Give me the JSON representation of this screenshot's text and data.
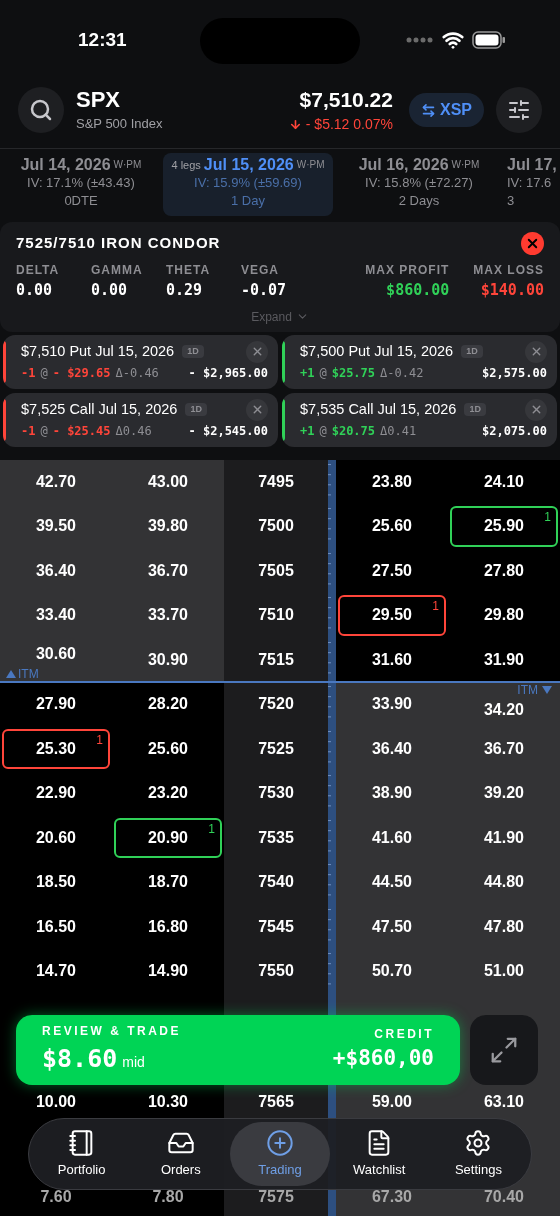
{
  "status_bar": {
    "time": "12:31"
  },
  "header": {
    "symbol": "SPX",
    "name": "S&P 500 Index",
    "price": "$7,510.22",
    "change": "- $5.12 0.07%",
    "down": true,
    "alt_symbol": "XSP"
  },
  "expirations": [
    {
      "date": "Jul 14, 2026",
      "tag": "W·PM",
      "iv": "IV: 17.1% (±43.43)",
      "dte": "0DTE",
      "selected": false
    },
    {
      "date": "Jul 15, 2026",
      "tag": "W·PM",
      "legs": "4 legs",
      "iv": "IV: 15.9% (±59.69)",
      "dte": "1 Day",
      "selected": true
    },
    {
      "date": "Jul 16, 2026",
      "tag": "W·PM",
      "iv": "IV: 15.8% (±72.27)",
      "dte": "2 Days",
      "selected": false
    },
    {
      "date": "Jul 17,",
      "iv": "IV: 17.6",
      "dte": "3",
      "selected": false
    }
  ],
  "strategy": {
    "title": "7525/7510 IRON CONDOR",
    "greeks": [
      {
        "label": "DELTA",
        "value": "0.00"
      },
      {
        "label": "GAMMA",
        "value": "0.00"
      },
      {
        "label": "THETA",
        "value": "0.29"
      },
      {
        "label": "VEGA",
        "value": "-0.07"
      }
    ],
    "limits": [
      {
        "label": "MAX PROFIT",
        "value": "$860.00",
        "color": "#30d158"
      },
      {
        "label": "MAX LOSS",
        "value": "$140.00",
        "color": "#ff453a"
      }
    ],
    "expand": "Expand"
  },
  "legs": [
    {
      "title": "$7,510 Put Jul 15, 2026",
      "tag": "1D",
      "color": "#ff453a",
      "qty": "-1",
      "at": "@",
      "price": "- $29.65",
      "delta": "Δ-0.46",
      "total": "- $2,965.00"
    },
    {
      "title": "$7,500 Put Jul 15, 2026",
      "tag": "1D",
      "color": "#30d158",
      "qty": "+1",
      "at": "@",
      "price": "$25.75",
      "delta": "Δ-0.42",
      "total": "$2,575.00"
    },
    {
      "title": "$7,525 Call Jul 15, 2026",
      "tag": "1D",
      "color": "#ff453a",
      "qty": "-1",
      "at": "@",
      "price": "- $25.45",
      "delta": "Δ0.46",
      "total": "- $2,545.00"
    },
    {
      "title": "$7,535 Call Jul 15, 2026",
      "tag": "1D",
      "color": "#30d158",
      "qty": "+1",
      "at": "@",
      "price": "$20.75",
      "delta": "Δ0.41",
      "total": "$2,075.00"
    }
  ],
  "chain": {
    "itm_label_calls": "ITM",
    "itm_label_puts": "ITM",
    "rows": [
      {
        "strike": "7495",
        "call_itm": true,
        "put_itm": false,
        "cells": [
          {
            "text": "42.70",
            "selected": false
          },
          {
            "text": "43.00",
            "selected": false
          },
          {
            "text": "23.80",
            "selected": false
          },
          {
            "text": "24.10",
            "selected": false
          }
        ]
      },
      {
        "strike": "7500",
        "call_itm": true,
        "put_itm": false,
        "cells": [
          {
            "text": "39.50",
            "selected": false
          },
          {
            "text": "39.80",
            "selected": false
          },
          {
            "text": "25.60",
            "selected": false
          },
          {
            "text": "25.90",
            "selected": true,
            "color": "#30d158",
            "qty": "1"
          }
        ]
      },
      {
        "strike": "7505",
        "call_itm": true,
        "put_itm": false,
        "cells": [
          {
            "text": "36.40",
            "selected": false
          },
          {
            "text": "36.70",
            "selected": false
          },
          {
            "text": "27.50",
            "selected": false
          },
          {
            "text": "27.80",
            "selected": false
          }
        ]
      },
      {
        "strike": "7510",
        "call_itm": true,
        "put_itm": false,
        "cells": [
          {
            "text": "33.40",
            "selected": false
          },
          {
            "text": "33.70",
            "selected": false
          },
          {
            "text": "29.50",
            "selected": true,
            "color": "#ff453a",
            "qty": "1"
          },
          {
            "text": "29.80",
            "selected": false
          }
        ]
      },
      {
        "strike": "7515",
        "call_itm": true,
        "put_itm": false,
        "cells": [
          {
            "text": "30.60",
            "selected": false
          },
          {
            "text": "30.90",
            "selected": false
          },
          {
            "text": "31.60",
            "selected": false
          },
          {
            "text": "31.90",
            "selected": false
          }
        ]
      },
      {
        "strike": "7520",
        "call_itm": false,
        "put_itm": true,
        "cells": [
          {
            "text": "27.90",
            "selected": false
          },
          {
            "text": "28.20",
            "selected": false
          },
          {
            "text": "33.90",
            "selected": false
          },
          {
            "text": "34.20",
            "selected": false
          }
        ]
      },
      {
        "strike": "7525",
        "call_itm": false,
        "put_itm": true,
        "cells": [
          {
            "text": "25.30",
            "selected": true,
            "color": "#ff453a",
            "qty": "1"
          },
          {
            "text": "25.60",
            "selected": false
          },
          {
            "text": "36.40",
            "selected": false
          },
          {
            "text": "36.70",
            "selected": false
          }
        ]
      },
      {
        "strike": "7530",
        "call_itm": false,
        "put_itm": true,
        "cells": [
          {
            "text": "22.90",
            "selected": false
          },
          {
            "text": "23.20",
            "selected": false
          },
          {
            "text": "38.90",
            "selected": false
          },
          {
            "text": "39.20",
            "selected": false
          }
        ]
      },
      {
        "strike": "7535",
        "call_itm": false,
        "put_itm": true,
        "cells": [
          {
            "text": "20.60",
            "selected": false
          },
          {
            "text": "20.90",
            "selected": true,
            "color": "#30d158",
            "qty": "1"
          },
          {
            "text": "41.60",
            "selected": false
          },
          {
            "text": "41.90",
            "selected": false
          }
        ]
      },
      {
        "strike": "7540",
        "call_itm": false,
        "put_itm": true,
        "cells": [
          {
            "text": "18.50",
            "selected": false
          },
          {
            "text": "18.70",
            "selected": false
          },
          {
            "text": "44.50",
            "selected": false
          },
          {
            "text": "44.80",
            "selected": false
          }
        ]
      },
      {
        "strike": "7545",
        "call_itm": false,
        "put_itm": true,
        "cells": [
          {
            "text": "16.50",
            "selected": false
          },
          {
            "text": "16.80",
            "selected": false
          },
          {
            "text": "47.50",
            "selected": false
          },
          {
            "text": "47.80",
            "selected": false
          }
        ]
      },
      {
        "strike": "7550",
        "call_itm": false,
        "put_itm": true,
        "cells": [
          {
            "text": "14.70",
            "selected": false
          },
          {
            "text": "14.90",
            "selected": false
          },
          {
            "text": "50.70",
            "selected": false
          },
          {
            "text": "51.00",
            "selected": false
          }
        ]
      }
    ],
    "lower_rows": [
      {
        "strike": "7565",
        "cells": [
          "10.00",
          "10.30",
          "59.00",
          "63.10"
        ]
      },
      {
        "strike": "7575",
        "cells": [
          "7.60",
          "7.80",
          "67.30",
          "70.40"
        ]
      }
    ]
  },
  "trade_bar": {
    "label": "REVIEW & TRADE",
    "price": "$8.60",
    "price_note": "mid",
    "side_label": "CREDIT",
    "amount": "+$860,00"
  },
  "tab_bar": [
    {
      "label": "Portfolio",
      "selected": false
    },
    {
      "label": "Orders",
      "selected": false
    },
    {
      "label": "Trading",
      "selected": true
    },
    {
      "label": "Watchlist",
      "selected": false
    },
    {
      "label": "Settings",
      "selected": false
    }
  ]
}
